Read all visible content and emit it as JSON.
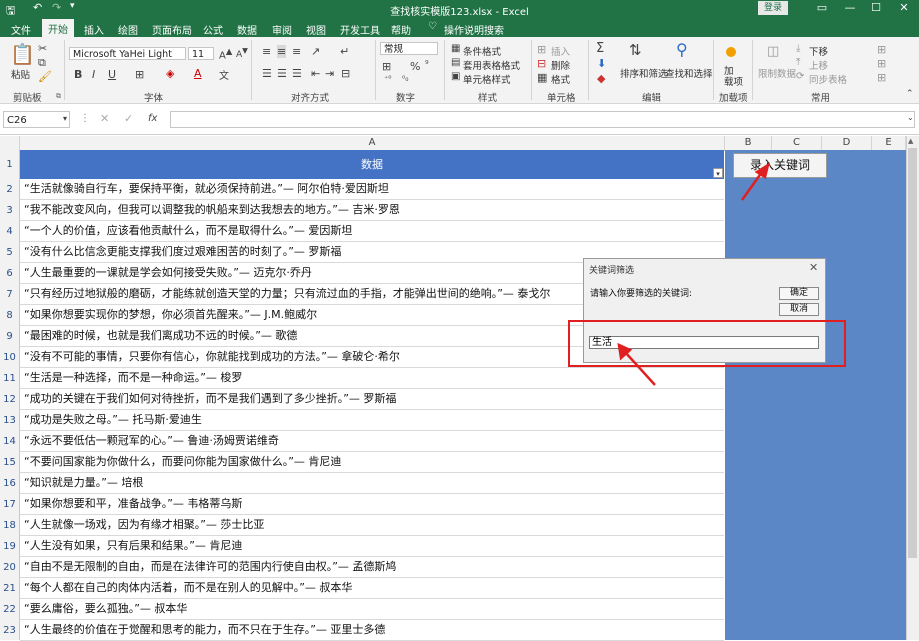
{
  "window": {
    "title": "查找核实模版123.xlsx - Excel",
    "login": "登录"
  },
  "tabs": [
    "文件",
    "开始",
    "插入",
    "绘图",
    "页面布局",
    "公式",
    "数据",
    "审阅",
    "视图",
    "开发工具",
    "帮助",
    "操作说明搜索"
  ],
  "ribbon": {
    "clipboard": {
      "paste": "粘贴",
      "group": "剪贴板"
    },
    "font": {
      "name": "Microsoft YaHei Light",
      "size": "11",
      "group": "字体"
    },
    "alignment": {
      "group": "对齐方式"
    },
    "number": {
      "format": "常规",
      "group": "数字"
    },
    "styles": {
      "conditional": "条件格式",
      "table": "套用表格格式",
      "cell": "单元格样式",
      "group": "样式"
    },
    "cells": {
      "insert": "插入",
      "delete": "删除",
      "format": "格式",
      "group": "单元格"
    },
    "editing": {
      "sort": "排序和筛选",
      "find": "查找和选择",
      "group": "编辑"
    },
    "addins": {
      "load": "加\n载项",
      "group": "加载项"
    },
    "common": {
      "limit": "限制数据",
      "down": "下移",
      "up": "上移",
      "sync": "同步表格",
      "group": "常用"
    }
  },
  "formula_bar": {
    "name_box": "C26",
    "fx": "fx",
    "value": ""
  },
  "columns": [
    "A",
    "B",
    "C",
    "D",
    "E"
  ],
  "header_cell": "数据",
  "rows": [
    {
      "n": "1",
      "text": ""
    },
    {
      "n": "2",
      "text": "“生活就像骑自行车，要保持平衡，就必须保持前进。”— 阿尔伯特·爱因斯坦"
    },
    {
      "n": "3",
      "text": "“我不能改变风向，但我可以调整我的帆船来到达我想去的地方。”— 吉米·罗恩"
    },
    {
      "n": "4",
      "text": "“一个人的价值，应该看他贡献什么，而不是取得什么。”— 爱因斯坦"
    },
    {
      "n": "5",
      "text": "“没有什么比信念更能支撑我们度过艰难困苦的时刻了。”— 罗斯福"
    },
    {
      "n": "6",
      "text": "“人生最重要的一课就是学会如何接受失败。”— 迈克尔·乔丹"
    },
    {
      "n": "7",
      "text": "“只有经历过地狱般的磨砺，才能练就创造天堂的力量；只有流过血的手指，才能弹出世间的绝响。”— 泰戈尔"
    },
    {
      "n": "8",
      "text": "“如果你想要实现你的梦想，你必须首先醒来。”— J.M.鲍威尔"
    },
    {
      "n": "9",
      "text": "“最困难的时候，也就是我们离成功不远的时候。”— 歌德"
    },
    {
      "n": "10",
      "text": "“没有不可能的事情，只要你有信心，你就能找到成功的方法。”— 拿破仑·希尔"
    },
    {
      "n": "11",
      "text": "“生活是一种选择，而不是一种命运。”— 梭罗"
    },
    {
      "n": "12",
      "text": "“成功的关键在于我们如何对待挫折，而不是我们遇到了多少挫折。”— 罗斯福"
    },
    {
      "n": "13",
      "text": "“成功是失败之母。”— 托马斯·爱迪生"
    },
    {
      "n": "14",
      "text": "“永远不要低估一颗冠军的心。”— 鲁迪·汤姆贾诺维奇"
    },
    {
      "n": "15",
      "text": "“不要问国家能为你做什么，而要问你能为国家做什么。”— 肯尼迪"
    },
    {
      "n": "16",
      "text": "“知识就是力量。”— 培根"
    },
    {
      "n": "17",
      "text": "“如果你想要和平，准备战争。”— 韦格蒂乌斯"
    },
    {
      "n": "18",
      "text": "“人生就像一场戏，因为有缘才相聚。”— 莎士比亚"
    },
    {
      "n": "19",
      "text": "“人生没有如果，只有后果和结果。”— 肯尼迪"
    },
    {
      "n": "20",
      "text": "“自由不是无限制的自由，而是在法律许可的范围内行使自由权。”— 孟德斯鸠"
    },
    {
      "n": "21",
      "text": "“每个人都在自己的肉体内活着，而不是在别人的见解中。”— 叔本华"
    },
    {
      "n": "22",
      "text": "“要么庸俗，要么孤独。”— 叔本华"
    },
    {
      "n": "23",
      "text": "“人生最终的价值在于觉醒和思考的能力，而不只在于生存。”— 亚里士多德"
    }
  ],
  "entry_button": "录入关键词",
  "dialog": {
    "title": "关键词筛选",
    "prompt": "请输入你要筛选的关键词:",
    "ok": "确定",
    "cancel": "取消",
    "input_value": "生活"
  },
  "colors": {
    "excel_green": "#217346",
    "header_blue": "#4472c4",
    "annotation_red": "#e02020"
  }
}
